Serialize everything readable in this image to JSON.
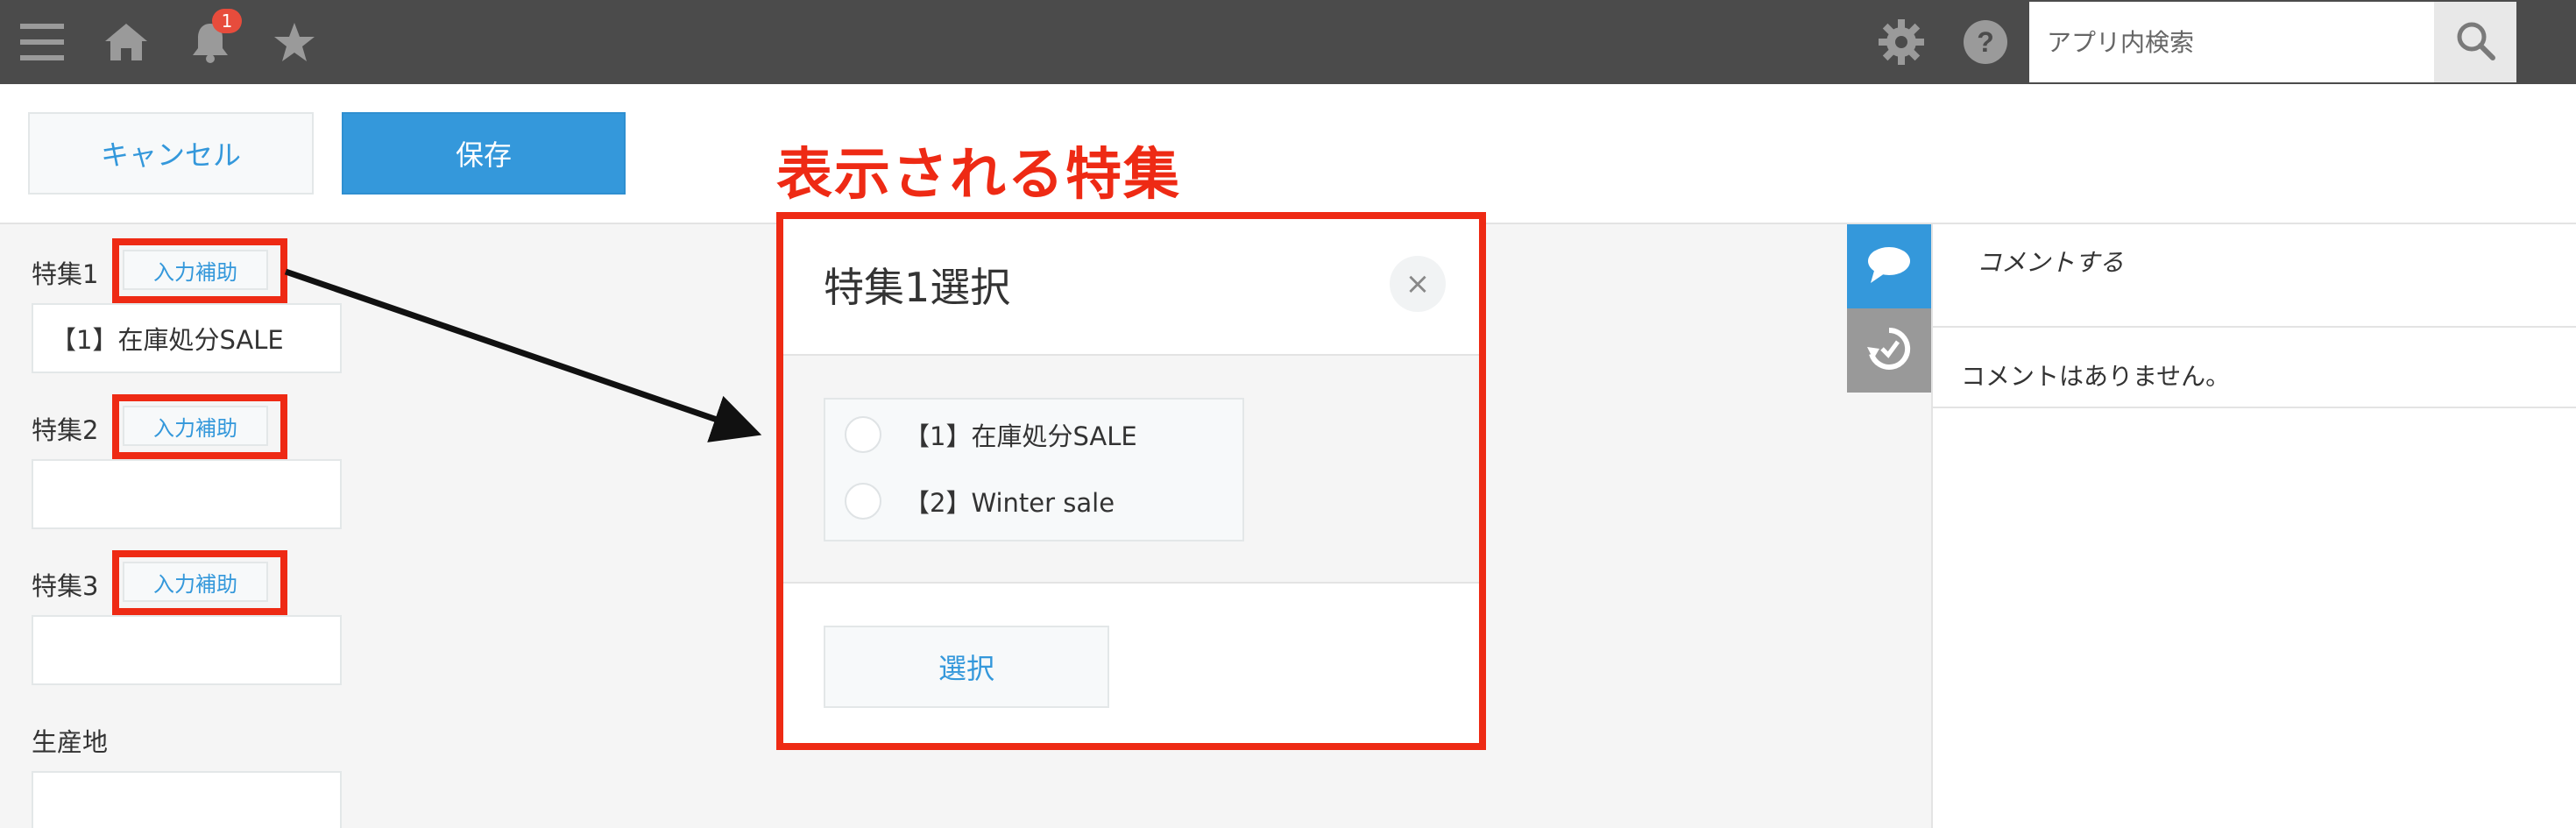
{
  "topbar": {
    "menu_icon": "hamburger-menu-icon",
    "home_icon": "home-icon",
    "notification_icon": "bell-icon",
    "notification_count": "1",
    "favorites_icon": "star-icon",
    "settings_icon": "gear-icon",
    "help_icon": "question-circle-icon",
    "search_placeholder": "アプリ内検索",
    "search_icon": "search-icon"
  },
  "actions": {
    "cancel_label": "キャンセル",
    "save_label": "保存"
  },
  "callout": {
    "title": "表示される特集",
    "color": "#ee2a14"
  },
  "form": {
    "fields": [
      {
        "label": "特集1",
        "assist_label": "入力補助",
        "value": "【1】在庫処分SALE"
      },
      {
        "label": "特集2",
        "assist_label": "入力補助",
        "value": ""
      },
      {
        "label": "特集3",
        "assist_label": "入力補助",
        "value": ""
      },
      {
        "label": "生産地",
        "value": ""
      }
    ]
  },
  "dialog": {
    "title": "特集1選択",
    "close_icon": "close-icon",
    "options": [
      {
        "label": "【1】在庫処分SALE",
        "selected": false
      },
      {
        "label": "【2】Winter sale",
        "selected": false
      }
    ],
    "select_label": "選択"
  },
  "side_panel": {
    "comment_tab_icon": "speech-bubble-icon",
    "history_tab_icon": "history-icon",
    "comment_placeholder": "コメントする",
    "no_comments_text": "コメントはありません。"
  },
  "colors": {
    "topbar": "#4b4b4b",
    "accent_blue": "#3498db",
    "highlight_red": "#ee2a14"
  }
}
